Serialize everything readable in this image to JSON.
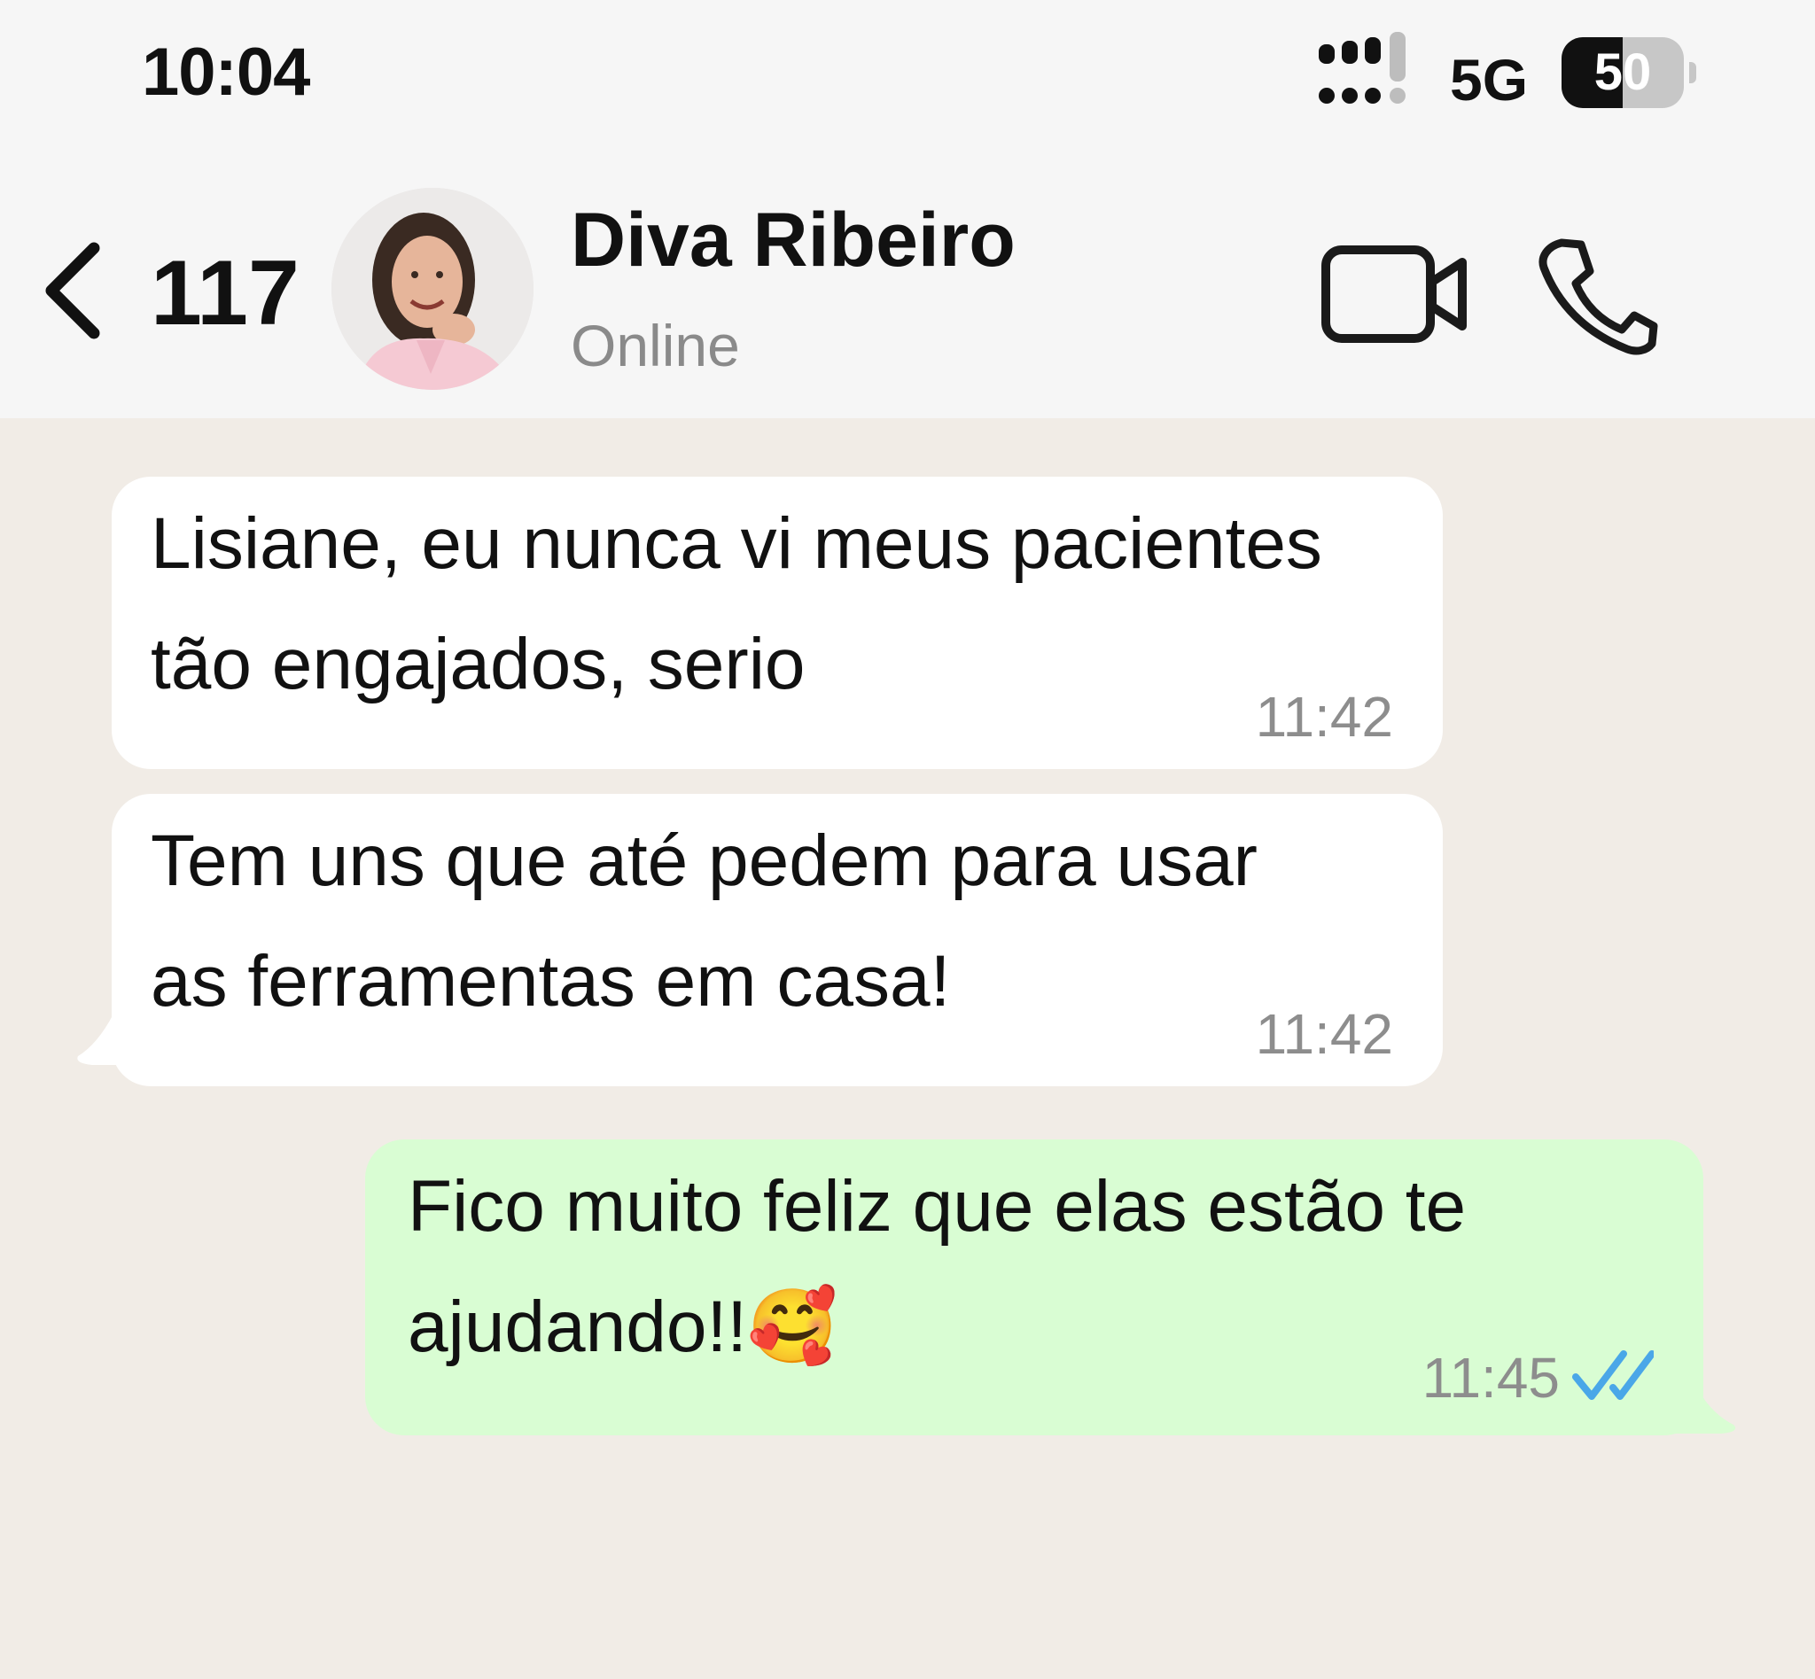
{
  "status_bar": {
    "time": "10:04",
    "network": "5G",
    "battery": "50",
    "battery_level": 0.5
  },
  "header": {
    "back_count": "117",
    "contact_name": "Diva Ribeiro",
    "contact_status": "Online",
    "icons": [
      "chevron-left-icon",
      "video-call-icon",
      "phone-call-icon"
    ]
  },
  "messages": [
    {
      "direction": "incoming",
      "text": "Lisiane, eu nunca vi meus pacientes\ntão engajados, serio",
      "time": "11:42"
    },
    {
      "direction": "incoming",
      "text": "Tem uns que até pedem para usar\nas ferramentas em casa!",
      "time": "11:42"
    },
    {
      "direction": "outgoing",
      "text": "Fico muito feliz que elas estão te\najudando!!🥰",
      "time": "11:45",
      "read": true
    }
  ],
  "colors": {
    "incoming_bubble": "#ffffff",
    "outgoing_bubble": "#d9fdd3",
    "chat_background": "#f1ece6",
    "read_ticks": "#4aa7e8"
  }
}
